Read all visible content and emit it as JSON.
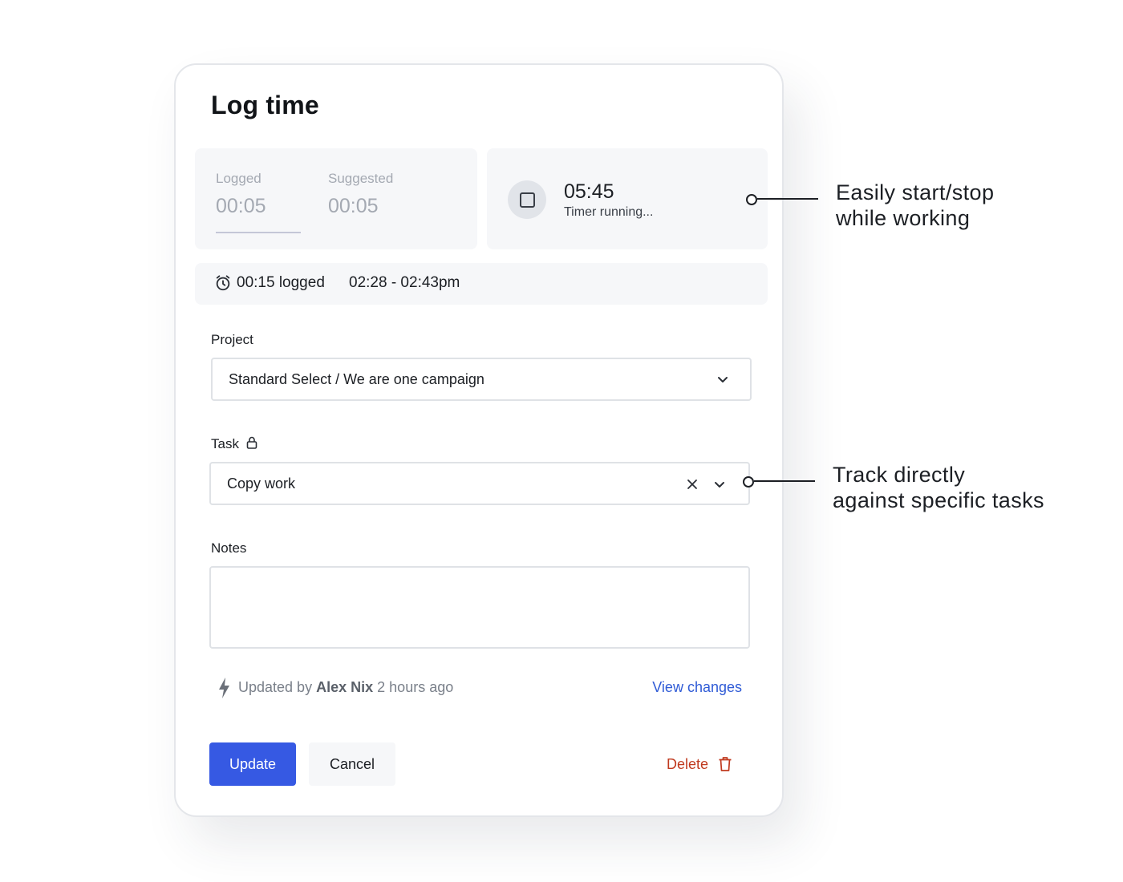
{
  "dialog": {
    "title": "Log time",
    "stats": {
      "logged_label": "Logged",
      "logged_value": "00:05",
      "suggested_label": "Suggested",
      "suggested_value": "00:05"
    },
    "timer": {
      "time": "05:45",
      "status": "Timer running..."
    },
    "summary": {
      "logged": "00:15 logged",
      "range": "02:28 - 02:43pm"
    },
    "project": {
      "label": "Project",
      "value": "Standard Select / We are one campaign"
    },
    "task": {
      "label": "Task",
      "value": "Copy work"
    },
    "notes": {
      "label": "Notes",
      "value": ""
    },
    "updated": {
      "prefix": "Updated by",
      "user": "Alex Nix",
      "time": "2 hours ago",
      "link": "View changes"
    },
    "buttons": {
      "update": "Update",
      "cancel": "Cancel",
      "delete": "Delete"
    }
  },
  "annotations": {
    "timer": [
      "Easily start/stop",
      "while working"
    ],
    "task": [
      "Track directly",
      "against specific tasks"
    ]
  },
  "colors": {
    "primary": "#3659e3",
    "link": "#2f5bd6",
    "danger": "#c03a1f",
    "panel": "#f6f7f9"
  },
  "icons": [
    "stop-icon",
    "alarm-clock-icon",
    "chevron-down-icon",
    "lock-icon",
    "close-icon",
    "bolt-icon",
    "trash-icon"
  ]
}
